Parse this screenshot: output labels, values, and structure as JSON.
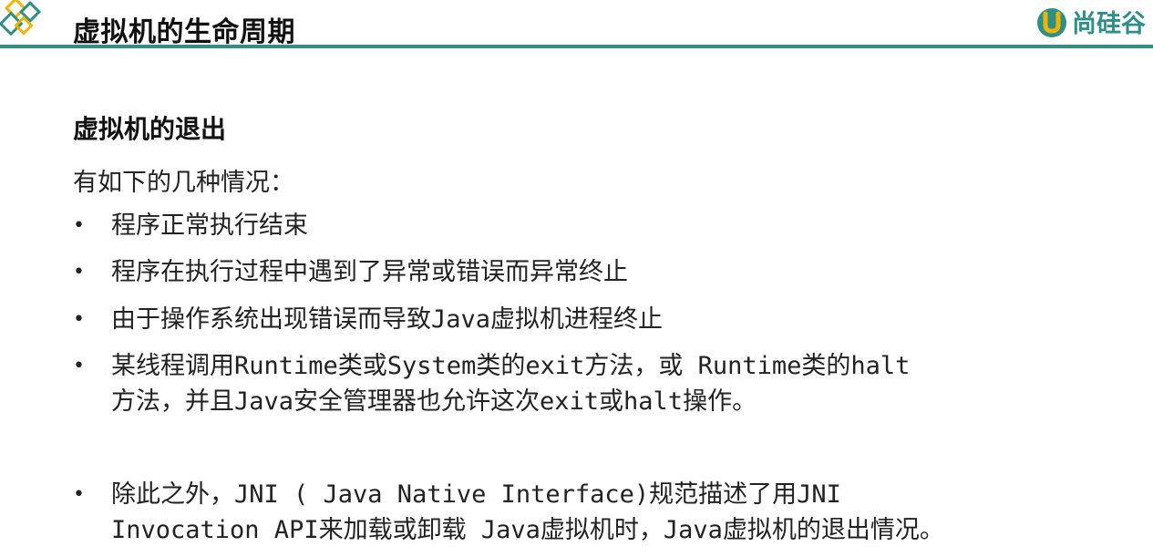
{
  "header": {
    "title": "虚拟机的生命周期",
    "brand_text": "尚硅谷",
    "accent_color": "#2e8f88",
    "decor_color": "#f0b400",
    "brand_icon": "u-logo-icon"
  },
  "content": {
    "section_title": "虚拟机的退出",
    "intro": "有如下的几种情况：",
    "bullets": [
      {
        "text": "程序正常执行结束"
      },
      {
        "text": "程序在执行过程中遇到了异常或错误而异常终止"
      },
      {
        "text": "由于操作系统出现错误而导致Java虚拟机进程终止"
      },
      {
        "text": "某线程调用Runtime类或System类的exit方法，或 Runtime类的halt\n方法，并且Java安全管理器也允许这次exit或halt操作。"
      },
      {
        "text": "除此之外，JNI ( Java Native Interface)规范描述了用JNI\nInvocation API来加载或卸载 Java虚拟机时，Java虚拟机的退出情况。"
      }
    ]
  }
}
